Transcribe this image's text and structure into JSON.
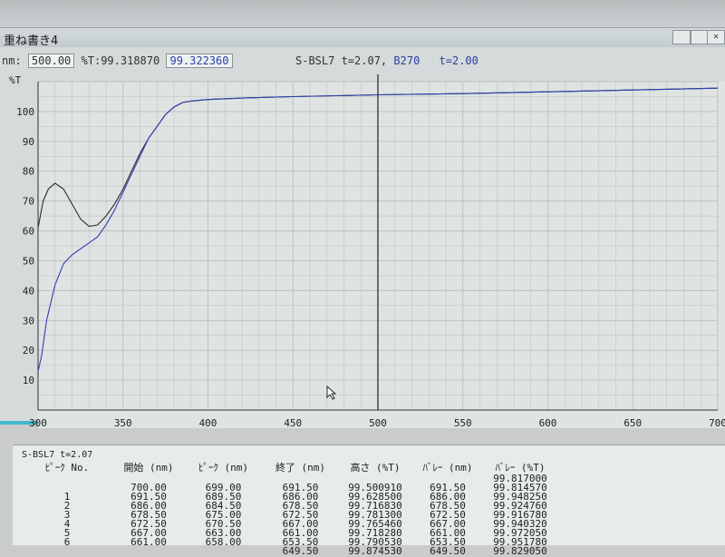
{
  "window": {
    "title": "重ね書き4",
    "button_glyph": "✕"
  },
  "readout": {
    "nm_label": "nm:",
    "nm_value": "500.00",
    "t_label": "%T:",
    "t_value1": "99.318870",
    "t_value2": "99.322360",
    "trace1_label": "S-BSL7 t=2.07,",
    "trace2_label": "B270",
    "trace2_t": "t=2.00"
  },
  "colors": {
    "trace1": "#2c2c2c",
    "trace2": "#2f3fb0",
    "grid": "#b9c0c0",
    "accent": "#41b6cf"
  },
  "chart_data": {
    "type": "line",
    "ylabel": "%T",
    "xlim": [
      300,
      700
    ],
    "ylim": [
      0,
      110
    ],
    "x_ticks": [
      "300",
      "350",
      "400",
      "450",
      "500",
      "550",
      "600",
      "650",
      "700"
    ],
    "y_ticks": [
      "10",
      "20",
      "30",
      "40",
      "50",
      "60",
      "70",
      "80",
      "90",
      "100"
    ],
    "cursor_x": 500,
    "series": [
      {
        "name": "S-BSL7 t=2.07",
        "x": [
          300,
          303,
          306,
          310,
          315,
          320,
          325,
          330,
          335,
          340,
          345,
          350,
          355,
          360,
          365,
          370,
          375,
          380,
          385,
          390,
          400,
          420,
          450,
          500,
          550,
          600,
          650,
          700
        ],
        "y": [
          61,
          70,
          74,
          76,
          74,
          69,
          64,
          61.5,
          62,
          65,
          69,
          74,
          80,
          86,
          91,
          95,
          99,
          101.5,
          103,
          103.5,
          104,
          104.5,
          105,
          105.6,
          106,
          106.6,
          107.2,
          107.8
        ]
      },
      {
        "name": "B270",
        "x": [
          300,
          302,
          305,
          310,
          315,
          320,
          325,
          330,
          335,
          340,
          345,
          350,
          355,
          360,
          365,
          370,
          375,
          380,
          385,
          390,
          400,
          420,
          450,
          500,
          550,
          600,
          650,
          700
        ],
        "y": [
          13,
          18,
          30,
          42,
          49,
          52,
          54,
          56,
          58,
          62,
          67,
          73,
          79,
          85,
          91,
          95,
          99,
          101.5,
          103,
          103.5,
          104,
          104.5,
          105,
          105.6,
          106,
          106.6,
          107.2,
          107.8
        ]
      }
    ]
  },
  "peak_table": {
    "caption": "S-BSL7 t=2.07",
    "headers": [
      "ﾋﾟｰｸ No.",
      "開始 (nm)",
      "ﾋﾟｰｸ (nm)",
      "終了 (nm)",
      "高さ (%T)",
      "ﾊﾞﾚｰ (nm)",
      "ﾊﾞﾚｰ (%T)"
    ],
    "rows": [
      [
        "",
        "",
        "",
        "",
        "",
        "",
        "99.817000"
      ],
      [
        "",
        "700.00",
        "699.00",
        "691.50",
        "99.500910",
        "691.50",
        "99.814570"
      ],
      [
        "1",
        "691.50",
        "689.50",
        "686.00",
        "99.628500",
        "686.00",
        "99.948250"
      ],
      [
        "2",
        "686.00",
        "684.50",
        "678.50",
        "99.716830",
        "678.50",
        "99.924760"
      ],
      [
        "3",
        "678.50",
        "675.00",
        "672.50",
        "99.781300",
        "672.50",
        "99.916780"
      ],
      [
        "4",
        "672.50",
        "670.50",
        "667.00",
        "99.765460",
        "667.00",
        "99.940320"
      ],
      [
        "5",
        "667.00",
        "663.00",
        "661.00",
        "99.718280",
        "661.00",
        "99.972050"
      ],
      [
        "6",
        "661.00",
        "658.00",
        "653.50",
        "99.790530",
        "653.50",
        "99.951780"
      ],
      [
        "",
        "",
        "",
        "649.50",
        "99.874530",
        "649.50",
        "99.829050"
      ]
    ]
  }
}
